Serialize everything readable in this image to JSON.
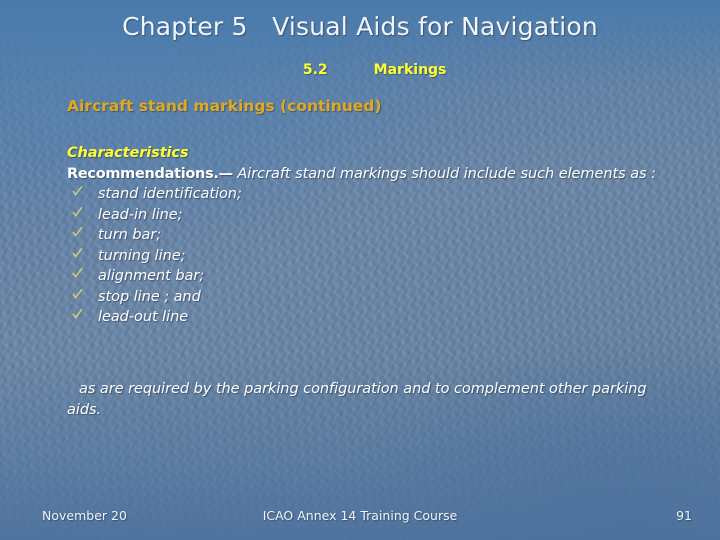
{
  "slide": {
    "title": "Chapter 5   Visual Aids for Navigation",
    "subtitle_number": "5.2",
    "subtitle_text": "Markings",
    "section_heading": "Aircraft stand markings (continued)",
    "characteristics_label": "Characteristics",
    "recommendation_label": "Recommendations.—",
    "recommendation_text": " Aircraft stand markings should include such elements as :",
    "bullet_icon": "check-icon",
    "bullets": [
      "stand identification;",
      "lead-in line;",
      "turn bar;",
      "turning line;",
      "alignment bar;",
      "stop line ; and",
      "lead-out line"
    ],
    "closing_paragraph": "as are required by the parking configuration and to complement other parking aids."
  },
  "footer": {
    "date": "November 20",
    "course": "ICAO Annex 14 Training Course",
    "page": "91"
  },
  "colors": {
    "background": "#6680a4",
    "title_text": "#f0f5fa",
    "accent_yellow": "#ffff33",
    "heading_gold": "#e0a91f",
    "body_text": "#ffffff"
  }
}
